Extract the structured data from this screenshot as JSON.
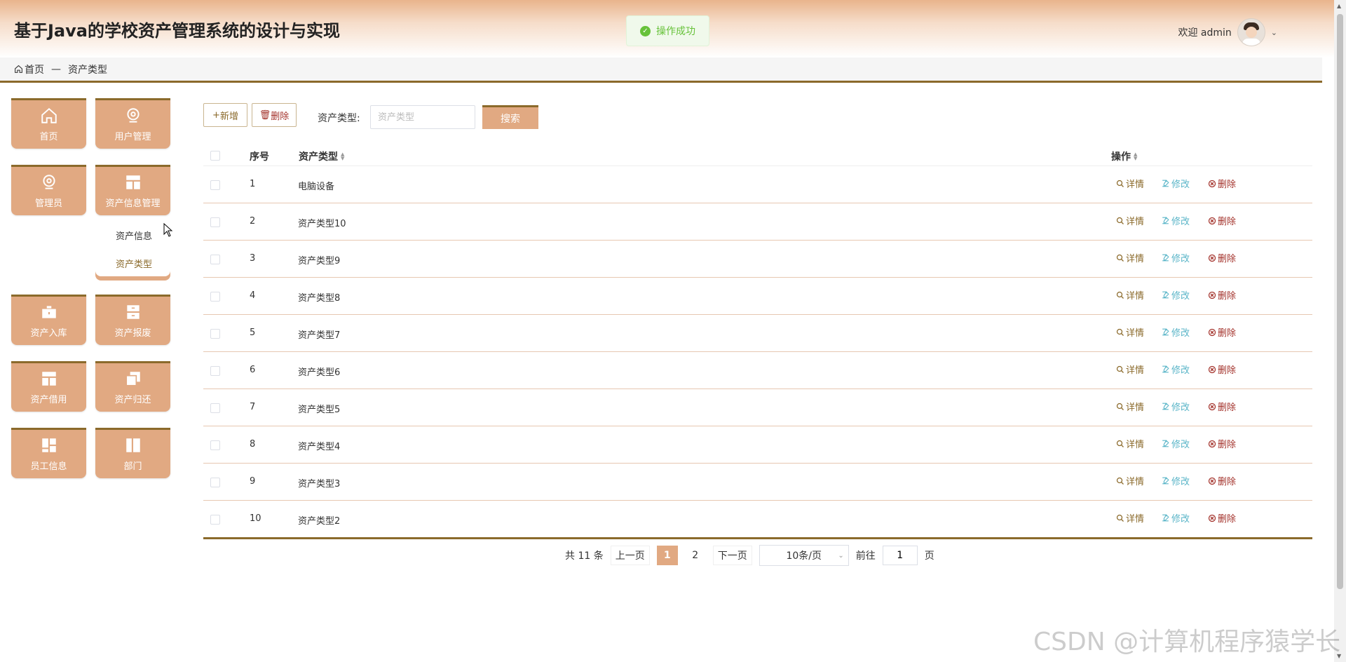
{
  "header": {
    "title": "基于Java的学校资产管理系统的设计与实现",
    "toast": "操作成功",
    "user_greeting": "欢迎 admin"
  },
  "breadcrumb": {
    "home": "首页",
    "separator": "—",
    "current": "资产类型"
  },
  "sidebar": {
    "tiles": [
      {
        "label": "首页",
        "icon": "home-icon"
      },
      {
        "label": "用户管理",
        "icon": "user-badge-icon"
      },
      {
        "label": "管理员",
        "icon": "user-badge-icon"
      },
      {
        "label": "资产信息管理",
        "icon": "layout-icon"
      },
      {
        "label": "资产入库",
        "icon": "briefcase-icon"
      },
      {
        "label": "资产报废",
        "icon": "archive-icon"
      },
      {
        "label": "资产借用",
        "icon": "layout-icon"
      },
      {
        "label": "资产归还",
        "icon": "copy-icon"
      },
      {
        "label": "员工信息",
        "icon": "grid-icon"
      },
      {
        "label": "部门",
        "icon": "columns-icon"
      }
    ],
    "submenu": [
      "资产信息",
      "资产类型"
    ]
  },
  "toolbar": {
    "add_label": "新增",
    "delete_label": "删除",
    "search_label": "资产类型:",
    "search_placeholder": "资产类型",
    "search_button": "搜索"
  },
  "table": {
    "headers": {
      "index": "序号",
      "type": "资产类型",
      "actions": "操作"
    },
    "actions": {
      "detail": "详情",
      "edit": "修改",
      "delete": "删除"
    },
    "rows": [
      {
        "index": "1",
        "type": "电脑设备"
      },
      {
        "index": "2",
        "type": "资产类型10"
      },
      {
        "index": "3",
        "type": "资产类型9"
      },
      {
        "index": "4",
        "type": "资产类型8"
      },
      {
        "index": "5",
        "type": "资产类型7"
      },
      {
        "index": "6",
        "type": "资产类型6"
      },
      {
        "index": "7",
        "type": "资产类型5"
      },
      {
        "index": "8",
        "type": "资产类型4"
      },
      {
        "index": "9",
        "type": "资产类型3"
      },
      {
        "index": "10",
        "type": "资产类型2"
      }
    ]
  },
  "pagination": {
    "total": "共 11 条",
    "prev": "上一页",
    "pages": [
      "1",
      "2"
    ],
    "current_page": "1",
    "next": "下一页",
    "page_size": "10条/页",
    "goto_label": "前往",
    "goto_value": "1",
    "page_suffix": "页"
  },
  "watermark": "CSDN @计算机程序猿学长",
  "colors": {
    "accent": "#e1a982",
    "accent_dark": "#8b6a2b",
    "edit": "#5ab5c8",
    "delete": "#a3322b",
    "success": "#67c23a"
  }
}
